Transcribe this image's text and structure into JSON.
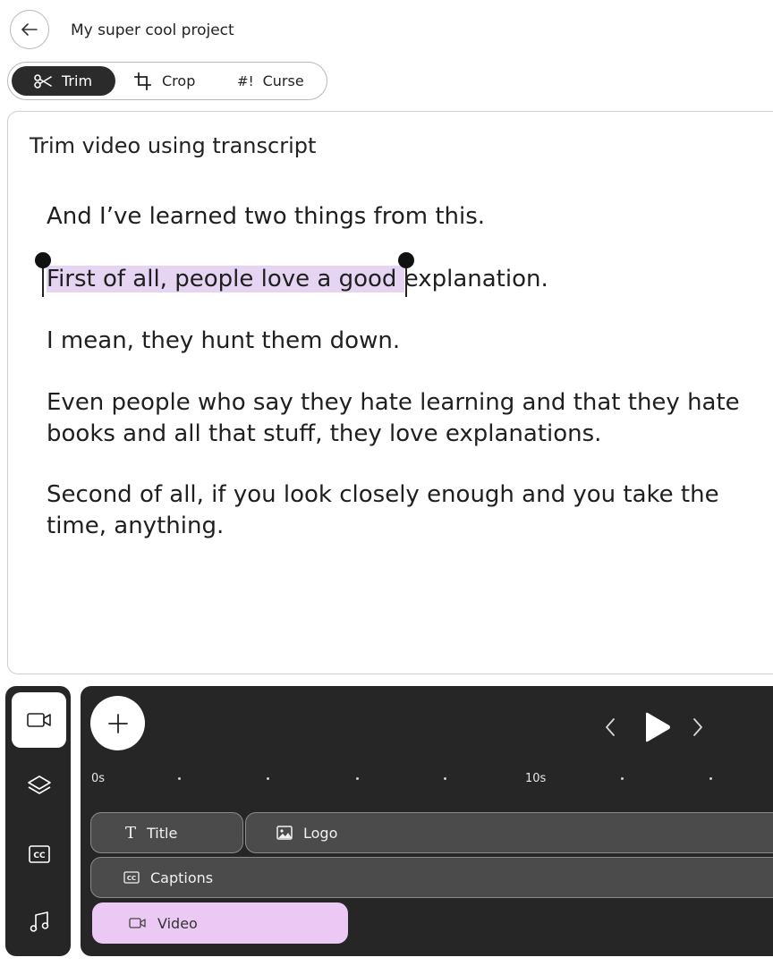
{
  "header": {
    "back_icon": "arrow-left-icon",
    "project_title": "My super cool project"
  },
  "modes": [
    {
      "label": "Trim",
      "icon": "scissors-icon",
      "active": true
    },
    {
      "label": "Crop",
      "icon": "crop-icon",
      "active": false
    },
    {
      "label": "Curse",
      "icon": "#!",
      "active": false
    }
  ],
  "editor": {
    "title": "Trim video using transcript",
    "paragraphs": [
      "And I’ve learned two things from this.",
      {
        "highlighted": "First of all, people love a good ",
        "rest": "explanation."
      },
      "I mean, they hunt them down.",
      "Even people who say they hate learning and that they hate books and all that stuff, they love explanations.",
      "Second of all, if you look closely enough and you take the time, anything."
    ],
    "highlight_color": "#e6d5f2"
  },
  "dock": {
    "items": [
      {
        "icon": "video-camera-icon",
        "active": true
      },
      {
        "icon": "layers-icon",
        "active": false
      },
      {
        "icon": "closed-captions-icon",
        "active": false
      },
      {
        "icon": "music-note-icon",
        "active": false
      }
    ]
  },
  "timeline": {
    "ruler": {
      "start_label": "0s",
      "mid_label": "10s"
    },
    "tracks": {
      "title": {
        "label": "Title",
        "icon": "T"
      },
      "logo": {
        "label": "Logo",
        "icon": "image-icon"
      },
      "captions": {
        "label": "Captions",
        "icon": "cc-icon"
      },
      "video": {
        "label": "Video",
        "icon": "video-camera-icon"
      }
    },
    "colors": {
      "background": "#262626",
      "video_clip": "#ecc9f5",
      "clip": "#4b4b4b"
    }
  }
}
